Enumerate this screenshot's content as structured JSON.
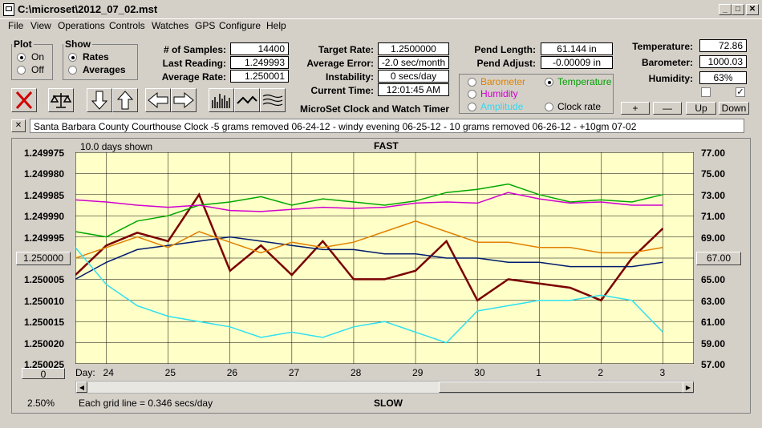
{
  "window": {
    "title": "C:\\microset\\2012_07_02.mst"
  },
  "menu": [
    "File",
    "View",
    "Operations",
    "Controls",
    "Watches",
    "GPS",
    "Configure",
    "Help"
  ],
  "plot": {
    "legend": "Plot",
    "on": "On",
    "off": "Off"
  },
  "show": {
    "legend": "Show",
    "rates": "Rates",
    "averages": "Averages"
  },
  "stats": {
    "samples_label": "# of Samples:",
    "samples": "14400",
    "last_label": "Last Reading:",
    "last": "1.249993",
    "avg_label": "Average Rate:",
    "avg": "1.250001",
    "target_label": "Target Rate:",
    "target": "1.2500000",
    "avgerr_label": "Average Error:",
    "avgerr": "-2.0 sec/month",
    "instab_label": "Instability:",
    "instab": "0 secs/day",
    "time_label": "Current Time:",
    "time": "12:01:45 AM",
    "pendlen_label": "Pend Length:",
    "pendlen": "61.144 in",
    "pendadj_label": "Pend Adjust:",
    "pendadj": "-0.00009 in",
    "temp_label": "Temperature:",
    "temp": "72.86",
    "baro_label": "Barometer:",
    "baro": "1000.03",
    "hum_label": "Humidity:",
    "hum": "63%"
  },
  "app_title": "MicroSet Clock and Watch Timer",
  "sensors": {
    "barometer": "Barometer",
    "temperature": "Temperature",
    "humidity": "Humidity",
    "amplitude": "Amplitude",
    "clockrate": "Clock rate"
  },
  "adj_buttons": {
    "plus": "+",
    "minus": "—",
    "up": "Up",
    "down": "Down"
  },
  "notes": {
    "close": "✕",
    "text": "Santa Barbara County Courthouse Clock -5 grams removed 06-24-12 - windy evening 06-25-12 - 10 grams removed 06-26-12 - +10gm 07-02"
  },
  "graph": {
    "days_shown": "10.0 days shown",
    "fast": "FAST",
    "slow": "SLOW",
    "day_label": "Day:",
    "grid_note": "Each grid line = 0.346 secs/day",
    "zoom": "2.50%",
    "left_btn": "1.250000",
    "right_btn": "67.00",
    "bottom_btn": "0",
    "colors": {
      "bg": "#ffffc8",
      "rate": "#7a0000",
      "avg": "#001a6e",
      "temp": "#00a800",
      "hum": "#d000d0",
      "baro": "#e08000",
      "amp": "#30e0f0"
    }
  },
  "chart_data": {
    "type": "line",
    "x": [
      23.5,
      24,
      24.5,
      25,
      25.5,
      26,
      26.5,
      27,
      27.5,
      28,
      28.5,
      29,
      29.5,
      30,
      30.5,
      31,
      31.5,
      32,
      32.5,
      33
    ],
    "yleft_ticks": [
      "1.249975",
      "1.249980",
      "1.249985",
      "1.249990",
      "1.249995",
      "1.250000",
      "1.250005",
      "1.250010",
      "1.250015",
      "1.250020",
      "1.250025"
    ],
    "yright_ticks": [
      "77.00",
      "75.00",
      "73.00",
      "71.00",
      "69.00",
      "67.00",
      "65.00",
      "63.00",
      "61.00",
      "59.00",
      "57.00"
    ],
    "x_ticks": [
      "24",
      "25",
      "26",
      "27",
      "28",
      "29",
      "30",
      "1",
      "2",
      "3"
    ],
    "ylim_left": [
      1.249975,
      1.250025
    ],
    "ylim_right": [
      57,
      77
    ],
    "series": [
      {
        "key": "rate",
        "values": [
          1.250004,
          1.249997,
          1.249994,
          1.249996,
          1.249985,
          1.250003,
          1.249997,
          1.250004,
          1.249996,
          1.250005,
          1.250005,
          1.250003,
          1.249996,
          1.25001,
          1.250005,
          1.250006,
          1.250007,
          1.25001,
          1.25,
          1.249993
        ]
      },
      {
        "key": "avg",
        "values": [
          1.250005,
          1.250001,
          1.249998,
          1.249997,
          1.249996,
          1.249995,
          1.249996,
          1.249997,
          1.249998,
          1.249998,
          1.249999,
          1.249999,
          1.25,
          1.25,
          1.250001,
          1.250001,
          1.250002,
          1.250002,
          1.250002,
          1.250001
        ]
      },
      {
        "key": "temp",
        "values": [
          69.5,
          69.0,
          70.5,
          71.0,
          72.0,
          72.3,
          72.8,
          72.0,
          72.6,
          72.3,
          72.0,
          72.4,
          73.2,
          73.5,
          74.0,
          73.0,
          72.3,
          72.5,
          72.3,
          73.0
        ]
      },
      {
        "key": "hum",
        "values": [
          72.5,
          72.3,
          72.0,
          71.8,
          72.0,
          71.5,
          71.4,
          71.6,
          71.8,
          71.7,
          71.8,
          72.2,
          72.3,
          72.2,
          73.2,
          72.6,
          72.2,
          72.3,
          72.0,
          72.0
        ]
      },
      {
        "key": "baro",
        "values": [
          67.0,
          68.0,
          69.0,
          68.0,
          69.5,
          68.5,
          67.5,
          68.5,
          68.0,
          68.5,
          69.5,
          70.5,
          69.5,
          68.5,
          68.5,
          68.0,
          68.0,
          67.5,
          67.5,
          68.0
        ]
      },
      {
        "key": "amp",
        "values": [
          68.0,
          64.5,
          62.5,
          61.5,
          61.0,
          60.5,
          59.5,
          60.0,
          59.5,
          60.5,
          61.0,
          60.0,
          59.0,
          62.0,
          62.5,
          63.0,
          63.0,
          63.5,
          63.0,
          60.0
        ]
      }
    ]
  }
}
